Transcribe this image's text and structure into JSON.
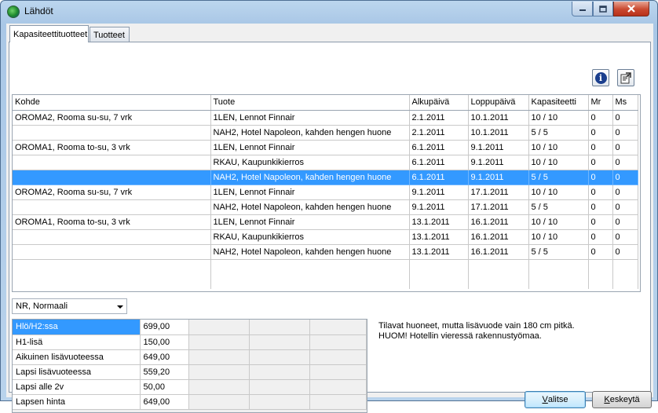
{
  "window": {
    "title": "Lähdöt"
  },
  "tabs": [
    {
      "label": "Kapasiteettituotteet"
    },
    {
      "label": "Tuotteet"
    }
  ],
  "departures": {
    "columns": [
      "Kohde",
      "Tuote",
      "Alkupäivä",
      "Loppupäivä",
      "Kapasiteetti",
      "Mr",
      "Ms"
    ],
    "rows": [
      {
        "kohde": "OROMA2, Rooma su-su, 7 vrk",
        "tuote": "1LEN, Lennot Finnair",
        "alku": "2.1.2011",
        "loppu": "10.1.2011",
        "kap": "10 / 10",
        "mr": "0",
        "ms": "0"
      },
      {
        "kohde": "",
        "tuote": "NAH2, Hotel Napoleon, kahden hengen huone",
        "alku": "2.1.2011",
        "loppu": "10.1.2011",
        "kap": "5 / 5",
        "mr": "0",
        "ms": "0"
      },
      {
        "kohde": "OROMA1, Rooma to-su, 3 vrk",
        "tuote": "1LEN, Lennot Finnair",
        "alku": "6.1.2011",
        "loppu": "9.1.2011",
        "kap": "10 / 10",
        "mr": "0",
        "ms": "0"
      },
      {
        "kohde": "",
        "tuote": "RKAU, Kaupunkikierros",
        "alku": "6.1.2011",
        "loppu": "9.1.2011",
        "kap": "10 / 10",
        "mr": "0",
        "ms": "0"
      },
      {
        "kohde": "",
        "tuote": "NAH2, Hotel Napoleon, kahden hengen huone",
        "alku": "6.1.2011",
        "loppu": "9.1.2011",
        "kap": "5 / 5",
        "mr": "0",
        "ms": "0"
      },
      {
        "kohde": "OROMA2, Rooma su-su, 7 vrk",
        "tuote": "1LEN, Lennot Finnair",
        "alku": "9.1.2011",
        "loppu": "17.1.2011",
        "kap": "10 / 10",
        "mr": "0",
        "ms": "0"
      },
      {
        "kohde": "",
        "tuote": "NAH2, Hotel Napoleon, kahden hengen huone",
        "alku": "9.1.2011",
        "loppu": "17.1.2011",
        "kap": "5 / 5",
        "mr": "0",
        "ms": "0"
      },
      {
        "kohde": "OROMA1, Rooma to-su, 3 vrk",
        "tuote": "1LEN, Lennot Finnair",
        "alku": "13.1.2011",
        "loppu": "16.1.2011",
        "kap": "10 / 10",
        "mr": "0",
        "ms": "0"
      },
      {
        "kohde": "",
        "tuote": "RKAU, Kaupunkikierros",
        "alku": "13.1.2011",
        "loppu": "16.1.2011",
        "kap": "10 / 10",
        "mr": "0",
        "ms": "0"
      },
      {
        "kohde": "",
        "tuote": "NAH2, Hotel Napoleon, kahden hengen huone",
        "alku": "13.1.2011",
        "loppu": "16.1.2011",
        "kap": "5 / 5",
        "mr": "0",
        "ms": "0"
      }
    ],
    "selected_row": 4
  },
  "price_type": {
    "selected": "NR, Normaali"
  },
  "prices": {
    "rows": [
      {
        "label": "Hlö/H2:ssa",
        "value": "699,00"
      },
      {
        "label": "H1-lisä",
        "value": "150,00"
      },
      {
        "label": "Aikuinen lisävuoteessa",
        "value": "649,00"
      },
      {
        "label": "Lapsi lisävuoteessa",
        "value": "559,20"
      },
      {
        "label": "Lapsi alle 2v",
        "value": "50,00"
      },
      {
        "label": "Lapsen hinta",
        "value": "649,00"
      }
    ],
    "selected_row": 0
  },
  "note": {
    "line1": "Tilavat huoneet, mutta lisävuode vain 180 cm pitkä.",
    "line2": "HUOM! Hotellin vieressä rakennustyömaa."
  },
  "buttons": {
    "valitse_first": "V",
    "valitse_rest": "alitse",
    "keskeyta_first": "K",
    "keskeyta_rest": "eskeytä"
  },
  "icons": {
    "info": "info-icon",
    "properties": "properties-icon"
  }
}
